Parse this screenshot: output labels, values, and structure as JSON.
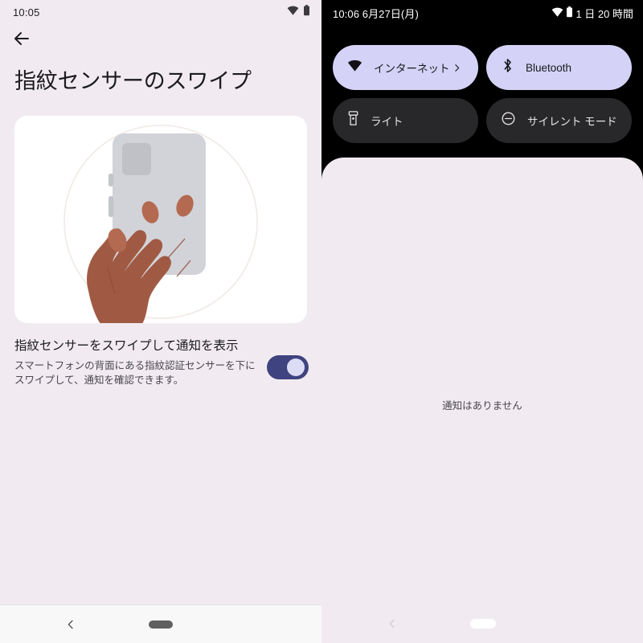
{
  "left_panel": {
    "status_bar": {
      "clock": "10:05",
      "wifi_icon": "wifi-icon",
      "battery_icon": "battery-icon"
    },
    "back_button": {
      "icon": "arrow-left-icon"
    },
    "page_title": "指紋センサーのスワイプ",
    "illustration": {
      "name": "fingerprint-swipe-illustration",
      "description": "手がスマートフォンの背面を持ち、指紋センサーをスワイプする図"
    },
    "setting": {
      "title": "指紋センサーをスワイプして通知を表示",
      "description": "スマートフォンの背面にある指紋認証センサーを下にスワイプして、通知を確認できます。",
      "toggle_state": "on"
    },
    "nav_bar": {
      "back_icon": "chevron-left-icon",
      "home_pill": "home-pill"
    }
  },
  "right_panel": {
    "status_bar": {
      "clock_date": "10:06 6月27日(月)",
      "wifi_icon": "wifi-icon",
      "battery_icon": "battery-icon",
      "battery_remaining": "1 日 20 時間"
    },
    "quick_settings": {
      "tiles": [
        {
          "label": "インターネット",
          "icon": "wifi-icon",
          "state": "active",
          "has_chevron": true,
          "chevron_icon": "chevron-right-icon"
        },
        {
          "label": "Bluetooth",
          "icon": "bluetooth-icon",
          "state": "active",
          "has_chevron": false
        },
        {
          "label": "ライト",
          "icon": "flashlight-icon",
          "state": "inactive",
          "has_chevron": false
        },
        {
          "label": "サイレント モード",
          "icon": "do-not-disturb-icon",
          "state": "inactive",
          "has_chevron": false
        }
      ]
    },
    "notification_shade": {
      "empty_text": "通知はありません"
    },
    "nav_bar": {
      "back_icon": "chevron-left-icon",
      "home_pill": "home-pill"
    }
  },
  "colors": {
    "background_lavender": "#f1ebf1",
    "shade_black": "#000000",
    "tile_active": "#d4d2f6",
    "tile_inactive": "#28282b",
    "toggle_track_on": "#3f4380",
    "toggle_thumb_on": "#dcdcf5",
    "text_primary": "#1c1b1f",
    "text_secondary": "#49454e"
  }
}
